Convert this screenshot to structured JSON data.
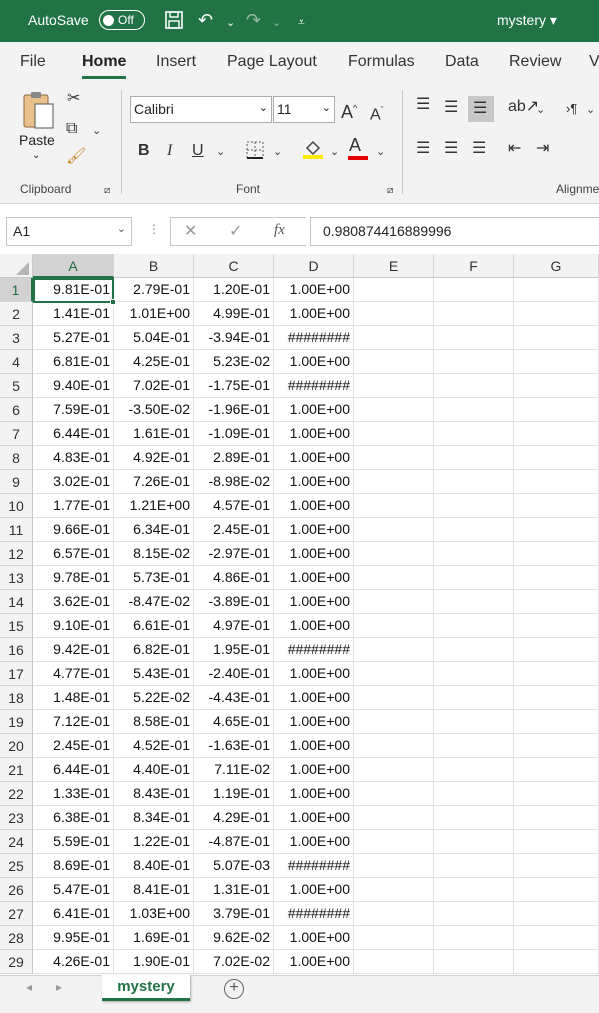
{
  "titlebar": {
    "autosave_label": "AutoSave",
    "autosave_state": "Off",
    "filename": "mystery",
    "filename_caret": "▾"
  },
  "tabs": [
    {
      "label": "File"
    },
    {
      "label": "Home"
    },
    {
      "label": "Insert"
    },
    {
      "label": "Page Layout"
    },
    {
      "label": "Formulas"
    },
    {
      "label": "Data"
    },
    {
      "label": "Review"
    },
    {
      "label": "V"
    }
  ],
  "ribbon": {
    "paste_label": "Paste",
    "clipboard_label": "Clipboard",
    "font_label": "Font",
    "alignment_label": "Alignme",
    "font_name": "Calibri",
    "font_size": "11",
    "bold": "B",
    "italic": "I",
    "underline": "U",
    "grow": "A",
    "shrink": "A",
    "fontcolor": "A"
  },
  "formula_bar": {
    "name_box": "A1",
    "fx": "fx",
    "value": "0.980874416889996"
  },
  "columns": [
    "A",
    "B",
    "C",
    "D",
    "E",
    "F",
    "G"
  ],
  "rows": [
    [
      "9.81E-01",
      "2.79E-01",
      "1.20E-01",
      "1.00E+00"
    ],
    [
      "1.41E-01",
      "1.01E+00",
      "4.99E-01",
      "1.00E+00"
    ],
    [
      "5.27E-01",
      "5.04E-01",
      "-3.94E-01",
      "########"
    ],
    [
      "6.81E-01",
      "4.25E-01",
      "5.23E-02",
      "1.00E+00"
    ],
    [
      "9.40E-01",
      "7.02E-01",
      "-1.75E-01",
      "########"
    ],
    [
      "7.59E-01",
      "-3.50E-02",
      "-1.96E-01",
      "1.00E+00"
    ],
    [
      "6.44E-01",
      "1.61E-01",
      "-1.09E-01",
      "1.00E+00"
    ],
    [
      "4.83E-01",
      "4.92E-01",
      "2.89E-01",
      "1.00E+00"
    ],
    [
      "3.02E-01",
      "7.26E-01",
      "-8.98E-02",
      "1.00E+00"
    ],
    [
      "1.77E-01",
      "1.21E+00",
      "4.57E-01",
      "1.00E+00"
    ],
    [
      "9.66E-01",
      "6.34E-01",
      "2.45E-01",
      "1.00E+00"
    ],
    [
      "6.57E-01",
      "8.15E-02",
      "-2.97E-01",
      "1.00E+00"
    ],
    [
      "9.78E-01",
      "5.73E-01",
      "4.86E-01",
      "1.00E+00"
    ],
    [
      "3.62E-01",
      "-8.47E-02",
      "-3.89E-01",
      "1.00E+00"
    ],
    [
      "9.10E-01",
      "6.61E-01",
      "4.97E-01",
      "1.00E+00"
    ],
    [
      "9.42E-01",
      "6.82E-01",
      "1.95E-01",
      "########"
    ],
    [
      "4.77E-01",
      "5.43E-01",
      "-2.40E-01",
      "1.00E+00"
    ],
    [
      "1.48E-01",
      "5.22E-02",
      "-4.43E-01",
      "1.00E+00"
    ],
    [
      "7.12E-01",
      "8.58E-01",
      "4.65E-01",
      "1.00E+00"
    ],
    [
      "2.45E-01",
      "4.52E-01",
      "-1.63E-01",
      "1.00E+00"
    ],
    [
      "6.44E-01",
      "4.40E-01",
      "7.11E-02",
      "1.00E+00"
    ],
    [
      "1.33E-01",
      "8.43E-01",
      "1.19E-01",
      "1.00E+00"
    ],
    [
      "6.38E-01",
      "8.34E-01",
      "4.29E-01",
      "1.00E+00"
    ],
    [
      "5.59E-01",
      "1.22E-01",
      "-4.87E-01",
      "1.00E+00"
    ],
    [
      "8.69E-01",
      "8.40E-01",
      "5.07E-03",
      "########"
    ],
    [
      "5.47E-01",
      "8.41E-01",
      "1.31E-01",
      "1.00E+00"
    ],
    [
      "6.41E-01",
      "1.03E+00",
      "3.79E-01",
      "########"
    ],
    [
      "9.95E-01",
      "1.69E-01",
      "9.62E-02",
      "1.00E+00"
    ],
    [
      "4.26E-01",
      "1.90E-01",
      "7.02E-02",
      "1.00E+00"
    ]
  ],
  "sheet": {
    "name": "mystery",
    "add": "+"
  },
  "colors": {
    "accent": "#217346"
  }
}
